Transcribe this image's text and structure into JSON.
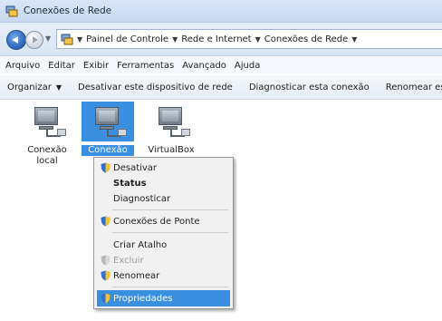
{
  "window": {
    "title": "Conexões de Rede"
  },
  "address_bar": {
    "breadcrumbs": [
      "Painel de Controle",
      "Rede e Internet",
      "Conexões de Rede"
    ]
  },
  "menu_bar": [
    "Arquivo",
    "Editar",
    "Exibir",
    "Ferramentas",
    "Avançado",
    "Ajuda"
  ],
  "command_bar": {
    "organize": "Organizar",
    "disable": "Desativar este dispositivo de rede",
    "diagnose": "Diagnosticar esta conexão",
    "rename": "Renomear es"
  },
  "connections": [
    {
      "line1": "Conexão",
      "line2": "local"
    },
    {
      "line1": "Conexão",
      "line2": ""
    },
    {
      "line1": "VirtualBox",
      "line2": ""
    }
  ],
  "context_menu": {
    "items": [
      {
        "label": "Desativar",
        "icon": "shield-icon"
      },
      {
        "label": "Status"
      },
      {
        "label": "Diagnosticar"
      },
      {
        "label": "Conexões de Ponte",
        "icon": "shield-icon"
      },
      {
        "label": "Criar Atalho"
      },
      {
        "label": "Excluir",
        "icon": "shield-icon",
        "disabled": true
      },
      {
        "label": "Renomear",
        "icon": "shield-icon"
      },
      {
        "label": "Propriedades",
        "icon": "shield-icon",
        "highlighted": true
      }
    ]
  },
  "colors": {
    "selection": "#3b8fe0",
    "titlebar": "#d9e6f6"
  }
}
